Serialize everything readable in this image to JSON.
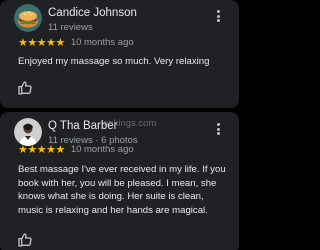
{
  "reviews": [
    {
      "reviewer_name": "Candice Johnson",
      "reviewer_meta": "11 reviews",
      "stars": "★★★★★",
      "time_ago": "10 months ago",
      "text": "Enjoyed my massage so much. Very relaxing",
      "avatar_icon": "bob-burger-avatar",
      "more_icon": "more-vert-icon",
      "like_icon": "thumb-up-icon"
    },
    {
      "reviewer_name": "Q Tha Barber",
      "reviewer_meta": "11 reviews · 6 photos",
      "stars": "★★★★★",
      "time_ago": "10 months ago",
      "text": "Best massage I've ever received in my life. If you book with her, you will be pleased. I mean, she knows what she is doing. Her suite is clean, music is relaxing and her hands are magical.",
      "avatar_icon": "person-photo-avatar",
      "more_icon": "more-vert-icon",
      "like_icon": "thumb-up-icon"
    }
  ],
  "watermark_text": "ankings.com",
  "colors": {
    "background": "#000000",
    "card": "#202124",
    "primary_text": "#e8eaed",
    "secondary_text": "#9aa0a6",
    "star": "#fbbc04"
  }
}
